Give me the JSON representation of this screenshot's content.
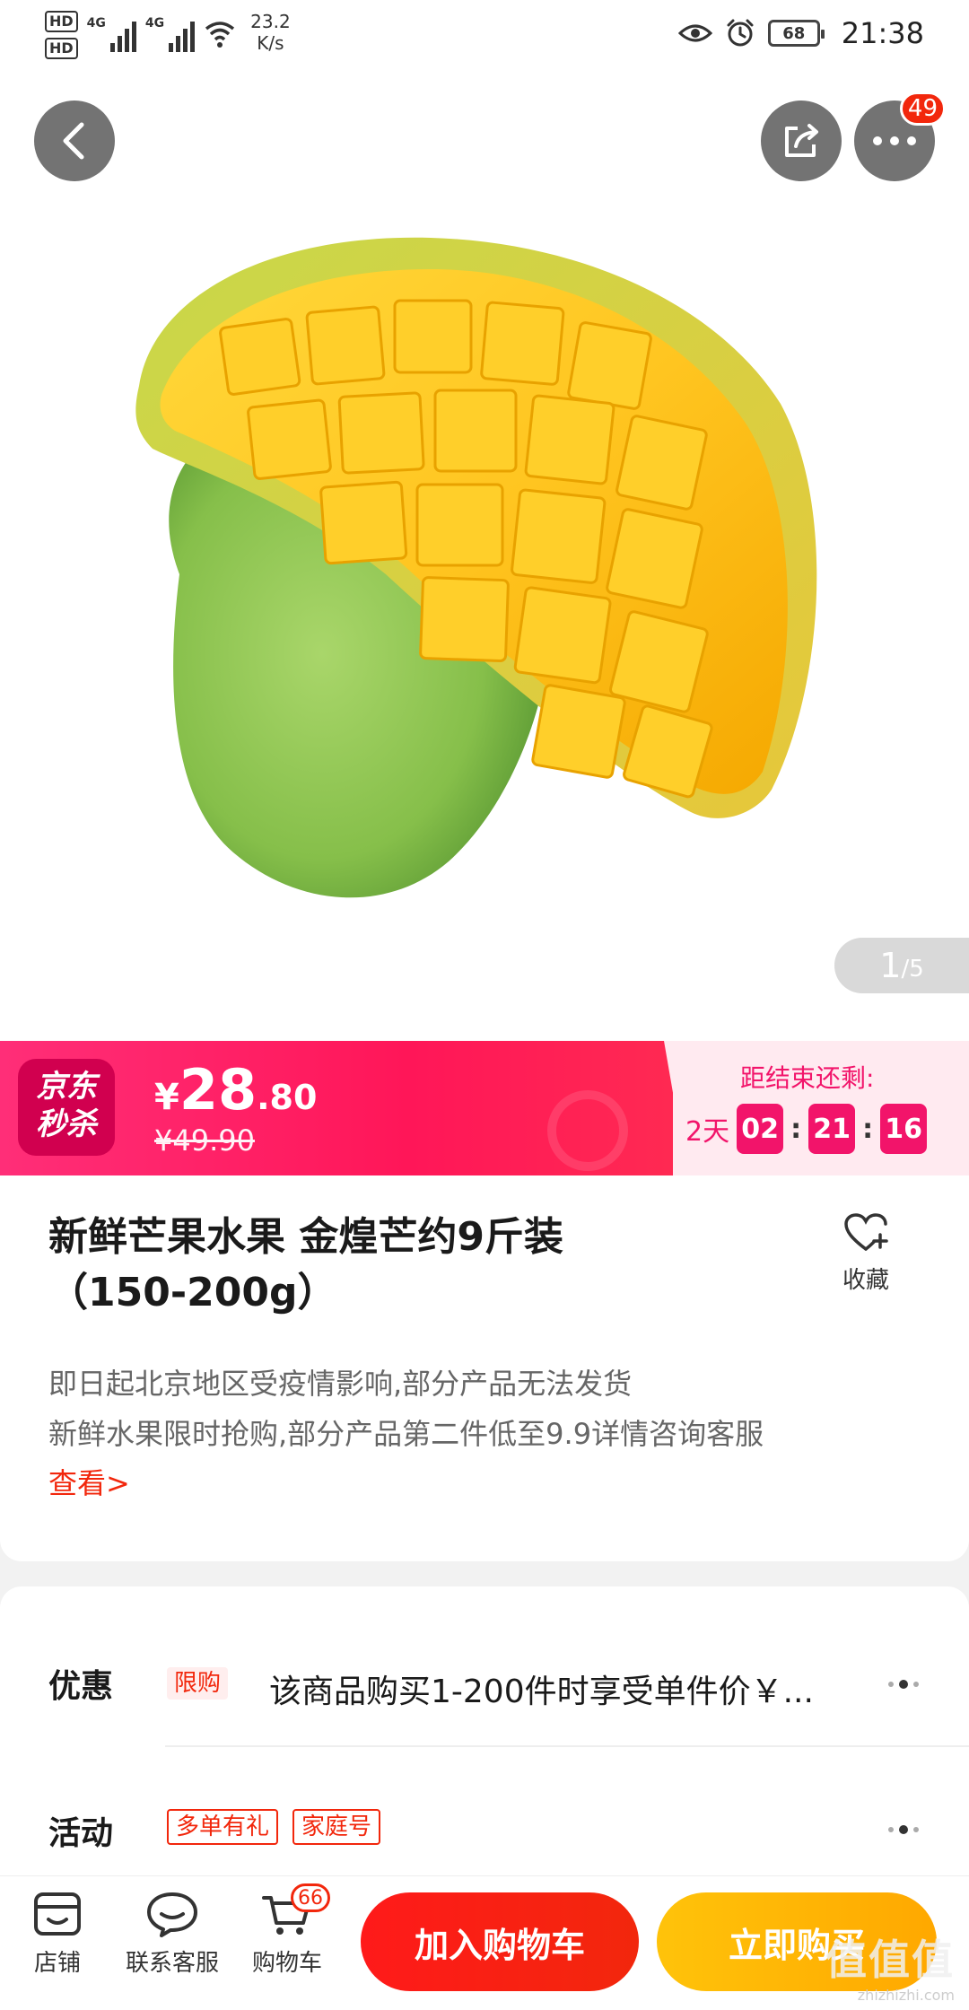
{
  "status_bar": {
    "sim1": "HD",
    "sim2": "HD",
    "net1": "4G",
    "net2": "4G",
    "speed_value": "23.2",
    "speed_unit": "K/s",
    "battery": "68",
    "time": "21:38",
    "icons": [
      "eye-comfort-icon",
      "alarm-icon"
    ]
  },
  "hero": {
    "more_badge": "49",
    "pager_current": "1",
    "pager_total": "/5",
    "icons": {
      "back": "chevron-left-icon",
      "share": "share-icon",
      "more": "more-dots-icon"
    }
  },
  "seckill": {
    "logo_line1": "京东",
    "logo_line2": "秒杀",
    "currency": "¥",
    "price_int": "28",
    "price_dec": ".80",
    "original_price": "¥49.90",
    "countdown_label": "距结束还剩:",
    "days": "2天",
    "hours": "02",
    "minutes": "21",
    "seconds": "16",
    "colors": {
      "gradient_start": "#ff2e78",
      "gradient_end": "#ff2a52",
      "accent": "#f2146a"
    }
  },
  "product": {
    "title_line1": "新鲜芒果水果 金煌芒约9斤装",
    "title_line2": "（150-200g）",
    "favorite_label": "收藏",
    "notice_line1": "即日起北京地区受疫情影响,部分产品无法发货",
    "notice_line2": "新鲜水果限时抢购,部分产品第二件低至9.9详情咨询客服",
    "see_more": "查看>"
  },
  "promotions": {
    "discount_label": "优惠",
    "discount_tag": "限购",
    "discount_text": "该商品购买1-200件时享受单件价￥...",
    "activity_label": "活动",
    "activity_tags": [
      "多单有礼",
      "家庭号"
    ]
  },
  "bottom_bar": {
    "store_label": "店铺",
    "service_label": "联系客服",
    "cart_label": "购物车",
    "cart_count": "66",
    "add_to_cart": "加入购物车",
    "buy_now": "立即购买"
  },
  "watermark": {
    "logo": "值值值",
    "url": "zhizhizhi.com"
  },
  "colors": {
    "jd_red": "#f2270c",
    "buy_yellow": "#ffa800"
  }
}
